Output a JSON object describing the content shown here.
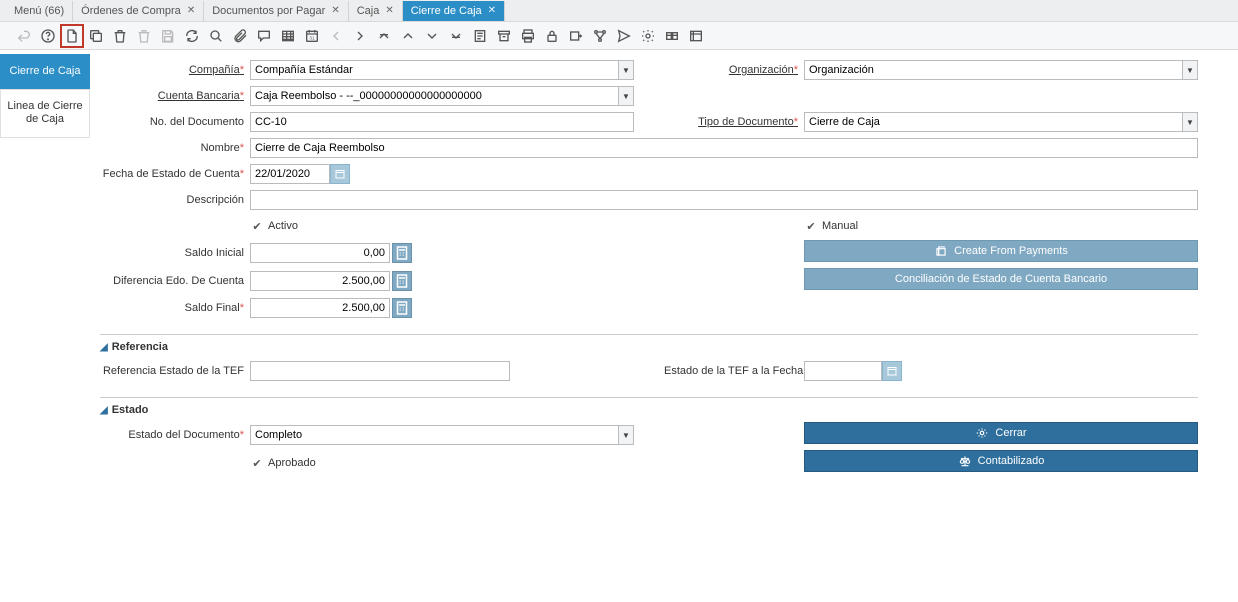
{
  "tabs": {
    "menu": "Menú (66)",
    "ordenes": "Órdenes de Compra",
    "documentos": "Documentos por Pagar",
    "caja": "Caja",
    "cierre": "Cierre de Caja"
  },
  "sidebar": {
    "cierre": "Cierre de Caja",
    "linea": "Linea de Cierre de Caja"
  },
  "labels": {
    "compania": "Compañía",
    "organizacion": "Organización",
    "cuenta_bancaria": "Cuenta Bancaria",
    "no_documento": "No. del Documento",
    "tipo_documento": "Tipo de Documento",
    "nombre": "Nombre",
    "fecha_estado": "Fecha de Estado de Cuenta",
    "descripcion": "Descripción",
    "activo": "Activo",
    "manual": "Manual",
    "saldo_inicial": "Saldo Inicial",
    "dif_edo": "Diferencia Edo. De Cuenta",
    "saldo_final": "Saldo Final",
    "referencia": "Referencia",
    "ref_tef": "Referencia Estado de la TEF",
    "estado_tef_fecha": "Estado de la TEF a la Fecha",
    "estado": "Estado",
    "estado_documento": "Estado del Documento",
    "aprobado": "Aprobado"
  },
  "values": {
    "compania": "Compañía Estándar",
    "organizacion": "Organización",
    "cuenta_bancaria": "Caja Reembolso - --_00000000000000000000",
    "no_documento": "CC-10",
    "tipo_documento": "Cierre de Caja",
    "nombre": "Cierre de Caja Reembolso",
    "fecha_estado": "22/01/2020",
    "descripcion": "",
    "saldo_inicial": "0,00",
    "dif_edo": "2.500,00",
    "saldo_final": "2.500,00",
    "ref_tef": "",
    "estado_tef_fecha": "",
    "estado_documento": "Completo"
  },
  "buttons": {
    "create_from_payments": "Create From Payments",
    "conciliacion": "Conciliación de Estado de Cuenta Bancario",
    "cerrar": "Cerrar",
    "contabilizado": "Contabilizado"
  }
}
